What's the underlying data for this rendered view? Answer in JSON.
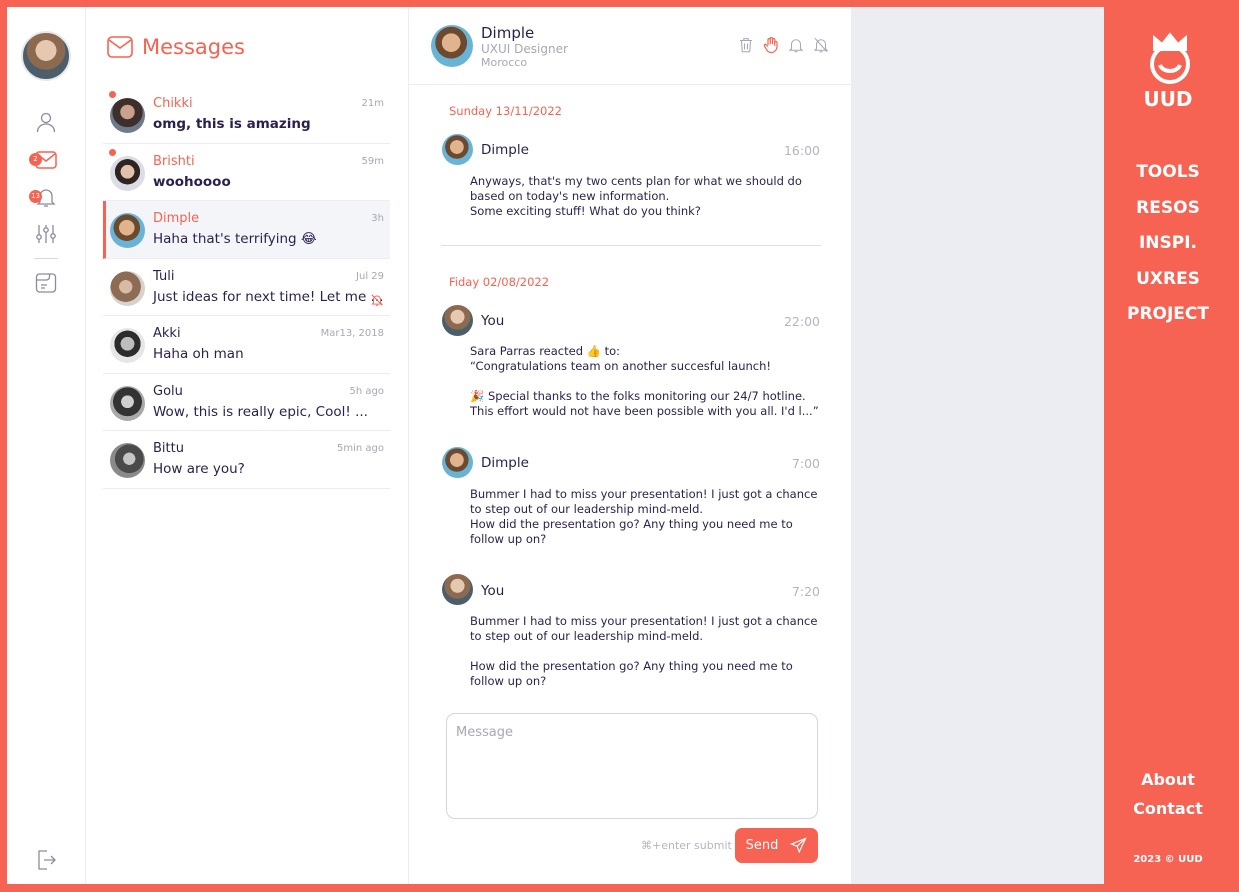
{
  "colors": {
    "accent": "#f66352",
    "text": "#2b1f4d",
    "muted": "#a7a7b7",
    "panel": "#ebedf2"
  },
  "rail": {
    "messages_badge": "2",
    "notifications_badge": "13"
  },
  "messages": {
    "title": "Messages",
    "conversations": [
      {
        "name": "Chikki",
        "time": "21m",
        "preview": "omg, this is amazing",
        "unread": true,
        "active": false
      },
      {
        "name": "Brishti",
        "time": "59m",
        "preview": "woohoooo",
        "unread": true,
        "active": false
      },
      {
        "name": "Dimple",
        "time": "3h",
        "preview": "Haha that's terrifying 😂",
        "unread": false,
        "active": true
      },
      {
        "name": "Tuli",
        "time": "Jul 29",
        "preview": "Just ideas for next time! Let me ...",
        "unread": false,
        "active": false,
        "muted": true
      },
      {
        "name": "Akki",
        "time": "Mar13, 2018",
        "preview": "Haha oh man",
        "unread": false,
        "active": false
      },
      {
        "name": "Golu",
        "time": "5h ago",
        "preview": "Wow, this is really epic, Cool! ...",
        "unread": false,
        "active": false
      },
      {
        "name": "Bittu",
        "time": "5min ago",
        "preview": "How are you?",
        "unread": false,
        "active": false
      }
    ]
  },
  "chat": {
    "contact": {
      "name": "Dimple",
      "role": "UXUI Designer",
      "location": "Morocco"
    },
    "dates": [
      "Sunday  13/11/2022",
      "Fiday  02/08/2022"
    ],
    "thread": [
      {
        "sender": "Dimple",
        "time": "16:00",
        "lines": [
          "Anyways, that's my two cents plan for what we should do based on today's new information.",
          "Some exciting stuff!  What do you think?"
        ]
      },
      {
        "sender": "You",
        "time": "22:00",
        "lines": [
          "Sara Parras reacted 👍 to:",
          "“Congratulations team on another succesful launch!",
          "",
          "🎉 Special thanks to the folks monitoring our 24/7 hotline. This effort would not have been possible with you all. I'd l...”"
        ]
      },
      {
        "sender": "Dimple",
        "time": "7:00",
        "lines": [
          "Bummer I had to miss your presentation! I just got a chance to step out of our leadership mind-meld.",
          "How did the presentation go? Any thing you need me to follow up on?"
        ]
      },
      {
        "sender": "You",
        "time": "7:20",
        "lines": [
          "Bummer I had to miss your presentation! I just got a chance to step out of our leadership mind-meld.",
          "",
          "How did the presentation go? Any thing you need me to follow up on?"
        ]
      }
    ],
    "composer": {
      "placeholder": "Message",
      "value": ""
    },
    "submit_hint": "⌘+enter submit",
    "send_label": "Send"
  },
  "brand": {
    "logo_text": "UUD",
    "nav": [
      "TOOLS",
      "RESOS",
      "INSPI.",
      "UXRES",
      "PROJECT"
    ],
    "footer_links": [
      "About",
      "Contact"
    ],
    "copyright": "2023 © UUD"
  }
}
